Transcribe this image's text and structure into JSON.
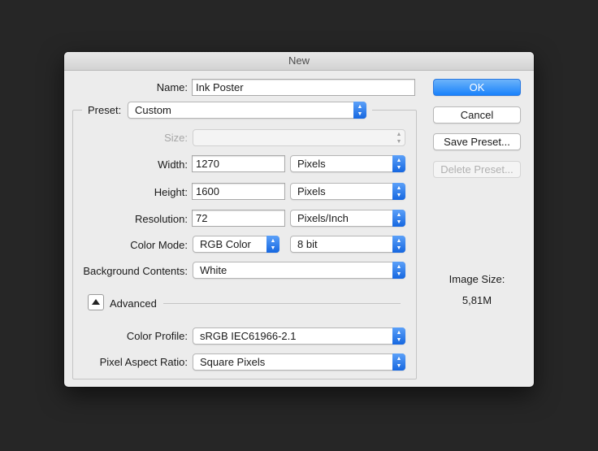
{
  "dialog": {
    "title": "New",
    "name_label": "Name:",
    "name_value": "Ink Poster",
    "preset_label": "Preset:",
    "preset_value": "Custom",
    "size_label": "Size:",
    "size_value": "",
    "width_label": "Width:",
    "width_value": "1270",
    "width_unit": "Pixels",
    "height_label": "Height:",
    "height_value": "1600",
    "height_unit": "Pixels",
    "resolution_label": "Resolution:",
    "resolution_value": "72",
    "resolution_unit": "Pixels/Inch",
    "color_mode_label": "Color Mode:",
    "color_mode_value": "RGB Color",
    "bit_depth_value": "8 bit",
    "background_label": "Background Contents:",
    "background_value": "White",
    "advanced_label": "Advanced",
    "color_profile_label": "Color Profile:",
    "color_profile_value": "sRGB IEC61966-2.1",
    "pixel_aspect_label": "Pixel Aspect Ratio:",
    "pixel_aspect_value": "Square Pixels"
  },
  "buttons": {
    "ok": "OK",
    "cancel": "Cancel",
    "save_preset": "Save Preset...",
    "delete_preset": "Delete Preset..."
  },
  "image_size": {
    "label": "Image Size:",
    "value": "5,81M"
  },
  "colors": {
    "accent": "#1a82fb",
    "background": "#262626",
    "dialog": "#ececec"
  },
  "icons": {
    "stepper": "up-down-chevron-icon",
    "disclosure": "triangle-up-icon"
  }
}
